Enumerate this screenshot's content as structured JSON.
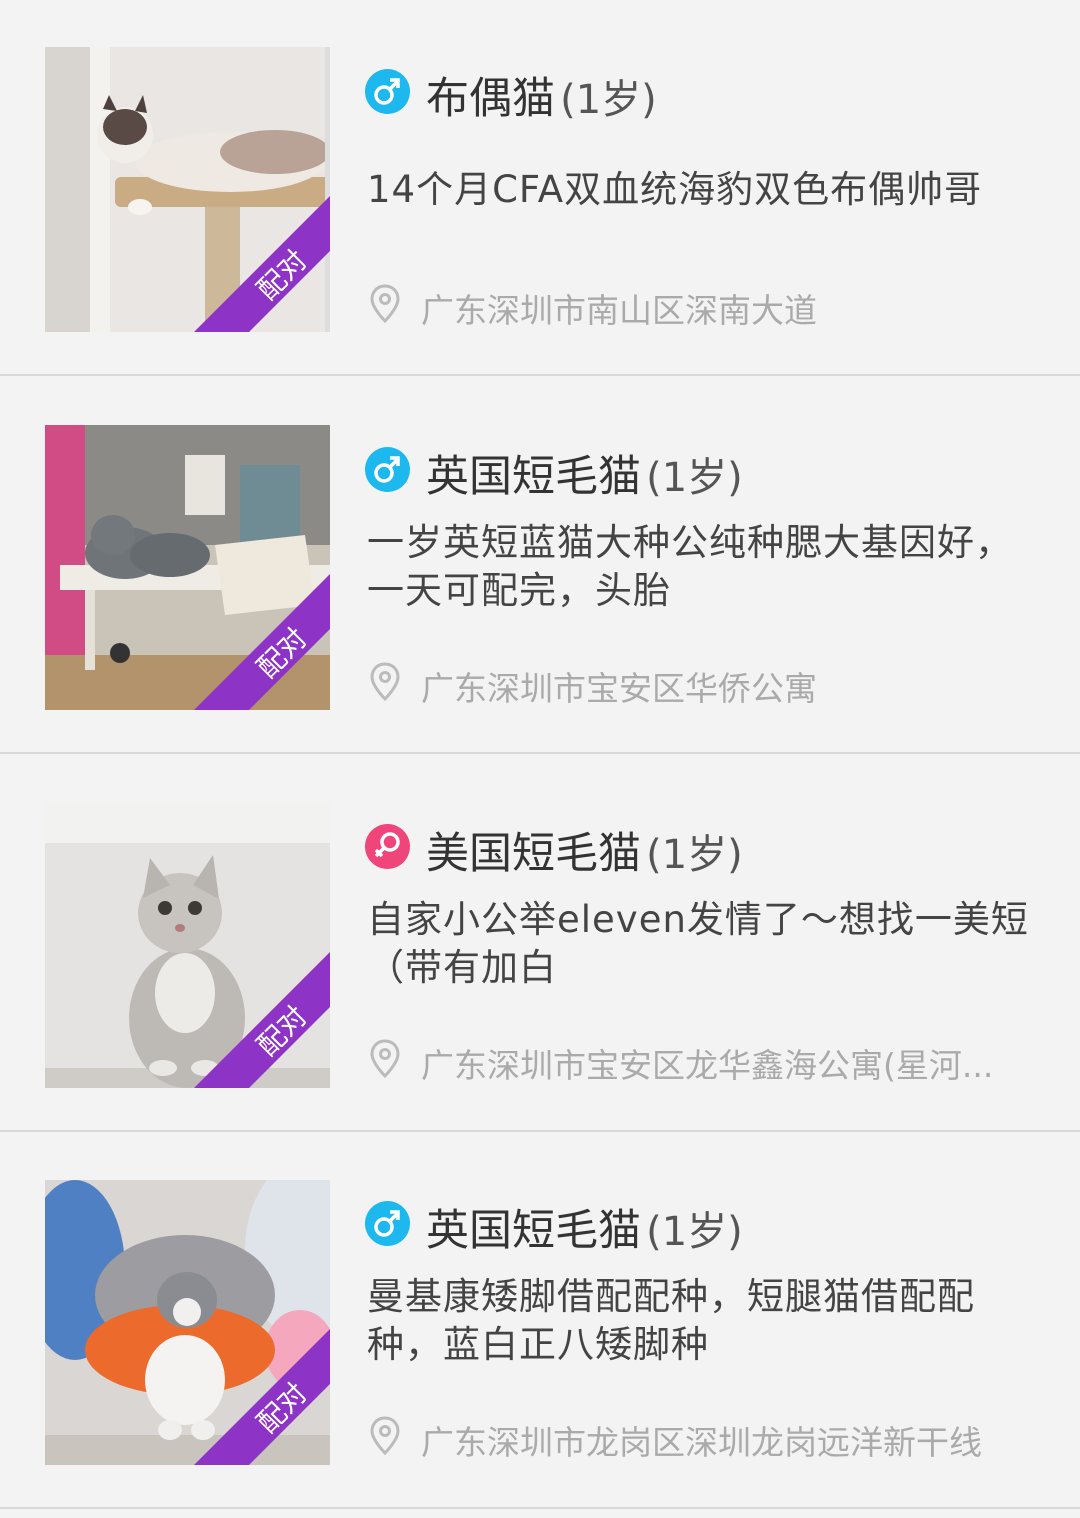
{
  "items": [
    {
      "gender": "male",
      "gender_icon": "male-icon",
      "name": "布偶猫",
      "age": "(1岁)",
      "description": "14个月CFA双血统海豹双色布偶帅哥",
      "location": "广东深圳市南山区深南大道",
      "badge": "配对"
    },
    {
      "gender": "male",
      "gender_icon": "male-icon",
      "name": "英国短毛猫",
      "age": "(1岁)",
      "description": "一岁英短蓝猫大种公纯种腮大基因好，一天可配完，头胎",
      "location": "广东深圳市宝安区华侨公寓",
      "badge": "配对"
    },
    {
      "gender": "female",
      "gender_icon": "female-icon",
      "name": "美国短毛猫",
      "age": "(1岁)",
      "description": "自家小公举eleven发情了～想找一美短（带有加白",
      "location": "广东深圳市宝安区龙华鑫海公寓(星河...",
      "badge": "配对"
    },
    {
      "gender": "male",
      "gender_icon": "male-icon",
      "name": "英国短毛猫",
      "age": "(1岁)",
      "description": "曼基康矮脚借配配种，短腿猫借配配种，蓝白正八矮脚种",
      "location": "广东深圳市龙岗区深圳龙岗远洋新干线",
      "badge": "配对"
    }
  ],
  "colors": {
    "male": "#1cb8ee",
    "female": "#f0457a",
    "badge": "#8d33c6",
    "background": "#f3f3f3"
  }
}
